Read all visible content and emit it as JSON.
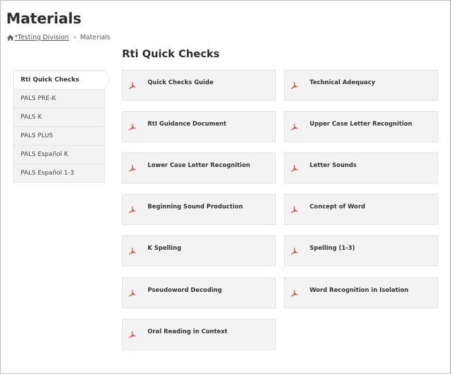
{
  "page": {
    "title": "Materials",
    "section_title": "Rti Quick Checks"
  },
  "breadcrumb": {
    "home_icon": "home-icon",
    "division": "*Testing Division",
    "separator": "›",
    "current": "Materials"
  },
  "sidebar": {
    "items": [
      {
        "label": "Rti Quick Checks",
        "active": true
      },
      {
        "label": "PALS PRE-K",
        "active": false
      },
      {
        "label": "PALS K",
        "active": false
      },
      {
        "label": "PALS PLUS",
        "active": false
      },
      {
        "label": "PALS Español K",
        "active": false
      },
      {
        "label": "PALS Español 1-3",
        "active": false
      }
    ]
  },
  "documents": {
    "icon": "pdf-icon",
    "icon_color": "#d9534f",
    "items": [
      {
        "label": "Quick Checks Guide"
      },
      {
        "label": "Technical Adequacy"
      },
      {
        "label": "RtI Guidance Document"
      },
      {
        "label": "Upper Case Letter Recognition"
      },
      {
        "label": "Lower Case Letter Recognition"
      },
      {
        "label": "Letter Sounds"
      },
      {
        "label": "Beginning Sound Production"
      },
      {
        "label": "Concept of Word"
      },
      {
        "label": "K Spelling"
      },
      {
        "label": "Spelling (1-3)"
      },
      {
        "label": "Pseudoword Decoding"
      },
      {
        "label": "Word Recognition in Isolation"
      },
      {
        "label": "Oral Reading in Context"
      }
    ]
  }
}
